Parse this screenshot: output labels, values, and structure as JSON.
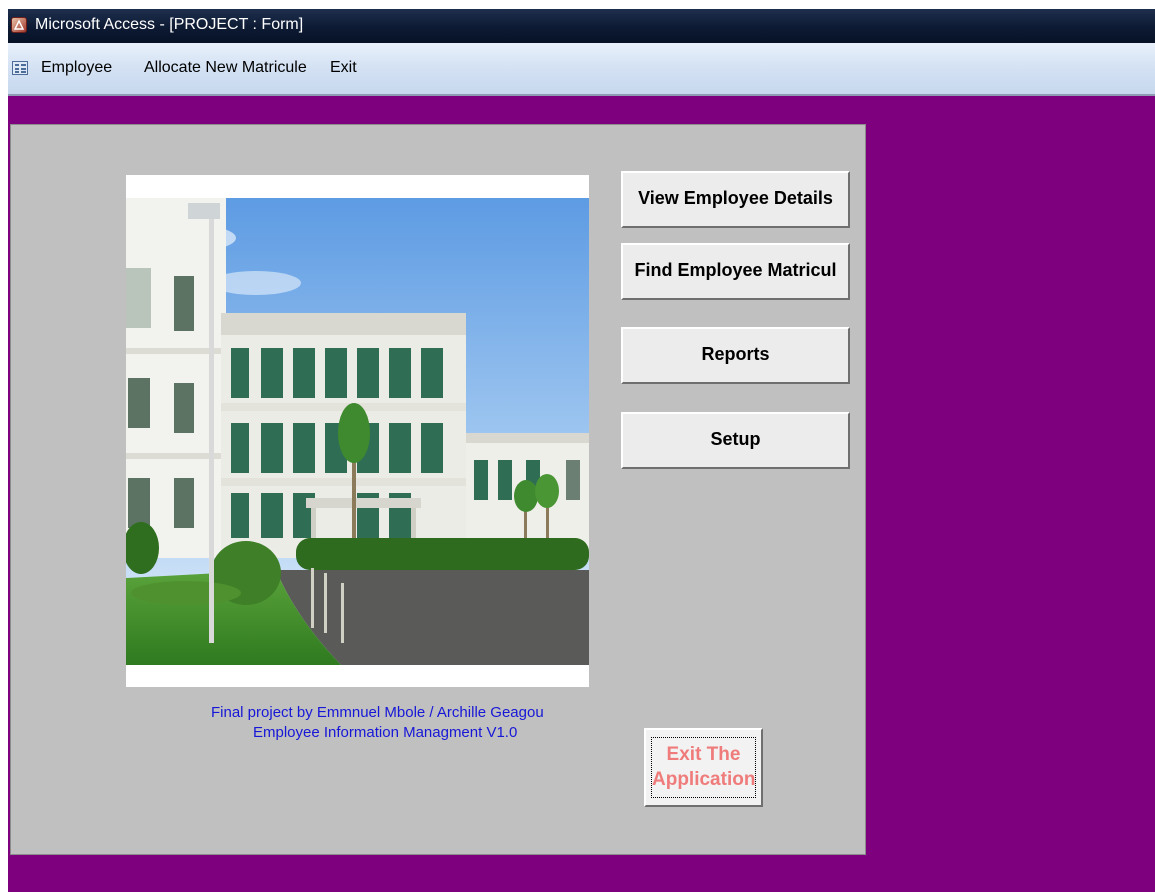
{
  "window": {
    "title": "Microsoft Access - [PROJECT : Form]"
  },
  "menubar": {
    "items": [
      {
        "label": "Employee"
      },
      {
        "label": "Allocate New Matricule"
      },
      {
        "label": "Exit"
      }
    ]
  },
  "form": {
    "buttons": {
      "view_employee_details": "View Employee Details",
      "find_employee_matricule": "Find Employee Matricul",
      "reports": "Reports",
      "setup": "Setup"
    },
    "exit_button": {
      "line1": "Exit The",
      "line2": "Application"
    },
    "credit": {
      "line1": "Final project by Emmnuel Mbole / Archille Geagou",
      "line2": "Employee Information Managment V1.0"
    }
  },
  "colors": {
    "client_background": "#7f007f",
    "form_background": "#c0c0c0",
    "credit_text": "#1717d8",
    "exit_text": "#ef7b7b"
  },
  "icons": {
    "app": "access-app-icon",
    "menu": "form-icon"
  }
}
